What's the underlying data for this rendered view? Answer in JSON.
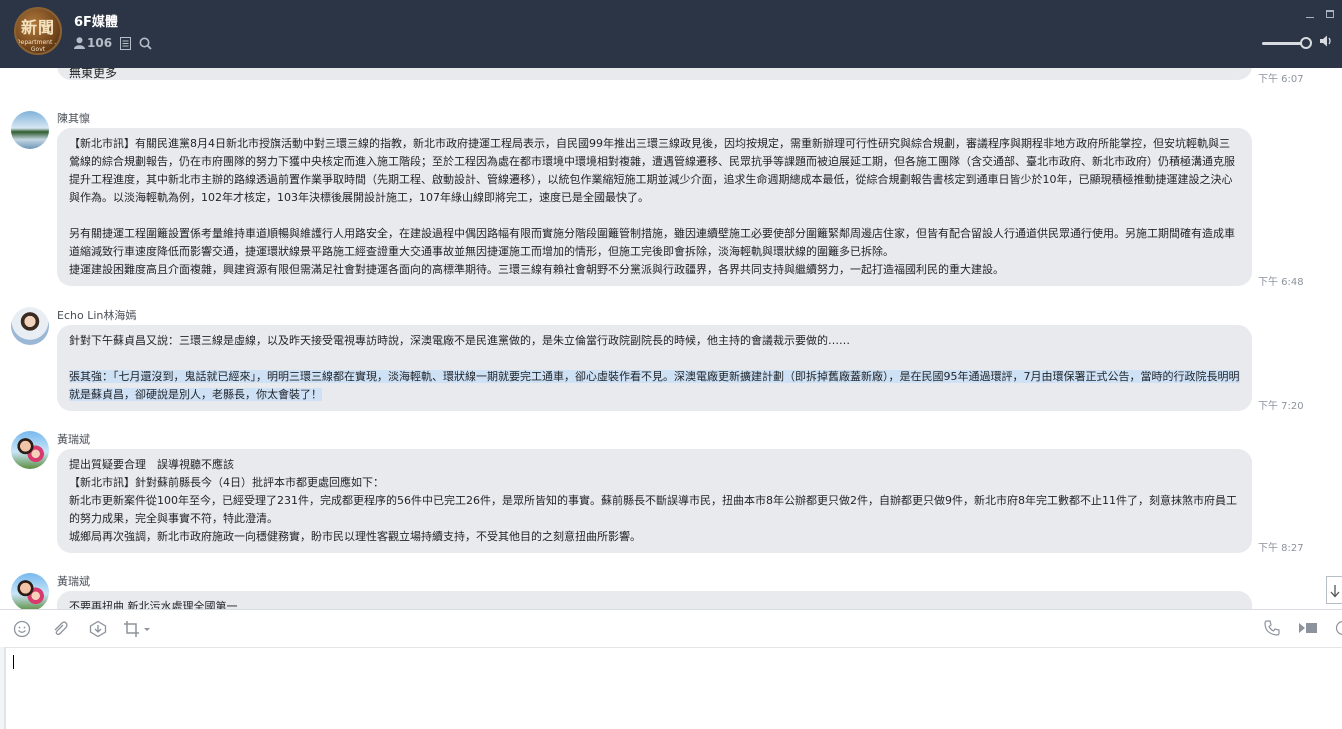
{
  "header": {
    "logo_text": "新聞",
    "logo_subtext": "Department ... Govt",
    "title": "6F媒體",
    "member_count": "106"
  },
  "previous_message": {
    "fragment": "無東更多",
    "time": "下午 6:07"
  },
  "messages": [
    {
      "sender": "陳其懔",
      "time": "下午 6:48",
      "paragraphs": [
        "【新北市訊】有關民進黨8月4日新北市授旗活動中對三環三線的指教，新北市政府捷運工程局表示，自民國99年推出三環三線政見後，因均按規定，需重新辦理可行性研究與綜合規劃，審議程序與期程非地方政府所能掌控，但安坑輕軌與三鶯線的綜合規劃報告，仍在市府團隊的努力下獲中央核定而進入施工階段；至於工程因為處在都市環境中環境相對複雜，遭遇管線遷移、民眾抗爭等課題而被迫展延工期，但各施工團隊（含交通部、臺北市政府、新北市政府）仍積極溝通克服提升工程進度，其中新北市主辦的路線透過前置作業爭取時間（先期工程、啟動設計、管線遷移），以統包作業縮短施工期並減少介面，追求生命週期總成本最低，從綜合規劃報告書核定到通車日皆少於10年，已顯現積極推動捷運建設之決心與作為。以淡海輕軌為例，102年才核定，103年決標後展開設計施工，107年綠山線即將完工，速度已是全國最快了。",
        "",
        "另有關捷運工程圍籬設置係考量維持車道順暢與維護行人用路安全，在建設過程中偶因路幅有限而實施分階段圍籬管制措施，雖因連續壁施工必要使部分圍籬緊鄰周邊店住家，但皆有配合留設人行通道供民眾通行使用。另施工期間確有造成車道縮減致行車速度降低而影響交通，捷運環狀線景平路施工經查證重大交通事故並無因捷運施工而增加的情形，但施工完後即會拆除，淡海輕軌與環狀線的圍籬多已拆除。",
        "捷運建設困難度高且介面複雜，興建資源有限但需滿足社會對捷運各面向的高標準期待。三環三線有賴社會朝野不分黨派與行政疆界，各界共同支持與繼續努力，一起打造福國利民的重大建設。"
      ]
    },
    {
      "sender": "Echo Lin林海嫣",
      "time": "下午 7:20",
      "paragraphs": [
        "針對下午蘇貞昌又說：三環三線是虛線，以及昨天接受電視專訪時說，深澳電廠不是民進黨做的，是朱立倫當行政院副院長的時候，他主持的會議裁示要做的……",
        "",
        "張其強：「七月還沒到，鬼話就已經來」，明明三環三線都在實現，淡海輕軌、環狀線一期就要完工通車，卻心虛裝作看不見。深澳電廠更新擴建計劃（即拆掉舊廠蓋新廠），是在民國95年通過環評，7月由環保署正式公告，當時的行政院長明明就是蘇貞昌，卻硬說是別人，老縣長，你太會裝了！"
      ]
    },
    {
      "sender": "黃瑞斌",
      "time": "下午 8:27",
      "paragraphs": [
        "提出質疑要合理　誤導視聽不應該",
        "【新北市訊】針對蘇前縣長今（4日）批評本市都更處回應如下：",
        "新北市更新案件從100年至今，已經受理了231件，完成都更程序的56件中已完工26件，是眾所皆知的事實。蘇前縣長不斷誤導市民，扭曲本市8年公辦都更只做2件，自辦都更只做9件，新北市府8年完工數都不止11件了，刻意抹煞市府員工的努力成果，完全與事實不符，特此澄清。",
        "城鄉局再次強調，新北市政府施政一向穩健務實，盼市民以理性客觀立場持續支持，不受其他目的之刻意扭曲所影響。"
      ]
    },
    {
      "sender": "黃瑞斌",
      "time": "",
      "paragraphs": [
        "不要再扭曲 新北污水處理全國第一"
      ]
    }
  ],
  "icons": {
    "member": "person-icon",
    "notes": "notes-icon",
    "search": "search-icon",
    "emoji": "emoji-icon",
    "attach": "paperclip-icon",
    "keep": "download-circle-icon",
    "crop": "crop-icon",
    "call": "phone-icon",
    "video": "video-icon",
    "more": "more-icon",
    "scroll_down": "scroll-down-icon",
    "volume": "speaker-icon"
  },
  "colors": {
    "header_bg": "#2b3545",
    "bubble_bg": "#e8eaee",
    "highlight": "#cfe1f5"
  }
}
